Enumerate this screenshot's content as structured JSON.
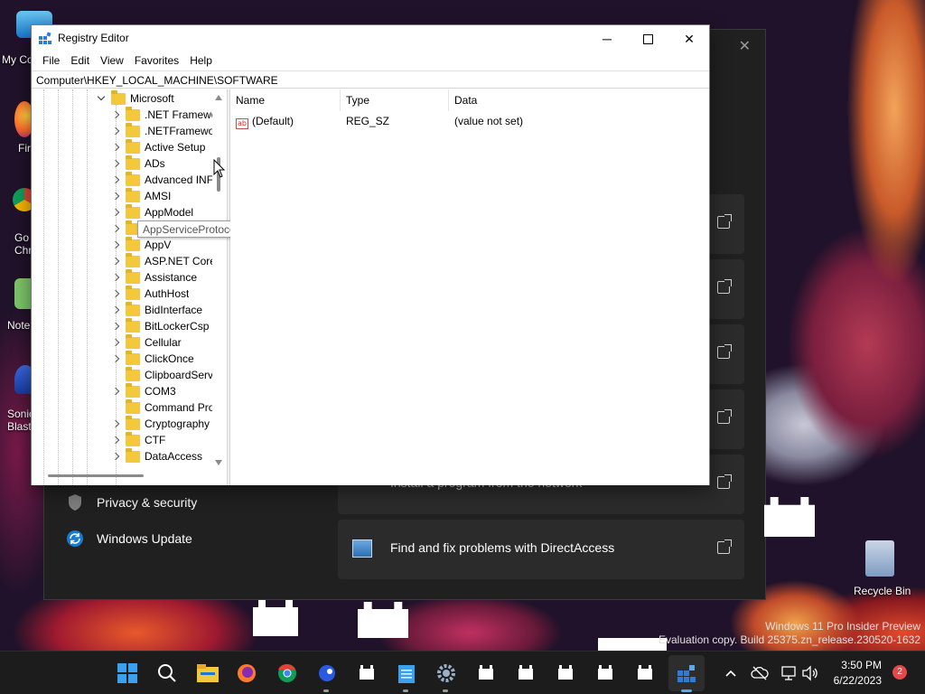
{
  "desktop": {
    "icons": [
      {
        "label": "My Co",
        "icon": "computer-icon"
      },
      {
        "label": "Fir",
        "icon": "firefox-icon"
      },
      {
        "label": "Go Chr",
        "icon": "chrome-icon"
      },
      {
        "label": "Note",
        "icon": "notepad-icon"
      },
      {
        "label": "Sonic Blast",
        "icon": "sonic-icon"
      }
    ],
    "recycle_bin": "Recycle Bin"
  },
  "settings": {
    "nav": [
      {
        "label": "Privacy & security",
        "icon": "shield-icon"
      },
      {
        "label": "Windows Update",
        "icon": "update-icon"
      }
    ],
    "cards": [
      {
        "label": ""
      },
      {
        "label": ""
      },
      {
        "label": ""
      },
      {
        "label": ""
      },
      {
        "label": "Install a program from the network"
      },
      {
        "label": "Find and fix problems with DirectAccess"
      }
    ]
  },
  "regedit": {
    "title": "Registry Editor",
    "menu": [
      "File",
      "Edit",
      "View",
      "Favorites",
      "Help"
    ],
    "address": "Computer\\HKEY_LOCAL_MACHINE\\SOFTWARE",
    "tree": {
      "parent": "Microsoft",
      "children": [
        ".NET Framewo",
        ".NETFramewo",
        "Active Setup",
        "ADs",
        "Advanced INF",
        "AMSI",
        "AppModel",
        "AppServiceProtocols",
        "AppV",
        "ASP.NET Core",
        "Assistance",
        "AuthHost",
        "BidInterface",
        "BitLockerCsp",
        "Cellular",
        "ClickOnce",
        "ClipboardServ",
        "COM3",
        "Command Pro",
        "Cryptography",
        "CTF",
        "DataAccess"
      ]
    },
    "tooltip": "AppServiceProtocols",
    "columns": [
      "Name",
      "Type",
      "Data"
    ],
    "rows": [
      {
        "name": "(Default)",
        "type": "REG_SZ",
        "data": "(value not set)"
      }
    ]
  },
  "taskbar": {
    "time": "3:50 PM",
    "date": "6/22/2023",
    "notification_count": "2"
  },
  "watermark": {
    "line1": "Windows 11 Pro Insider Preview",
    "line2": "Evaluation copy. Build 25375.zn_release.230520-1632"
  },
  "colors": {
    "accent": "#0078d4",
    "folder": "#f3c83a",
    "taskbar": "#1c1c1c",
    "settings_bg": "#202020"
  }
}
